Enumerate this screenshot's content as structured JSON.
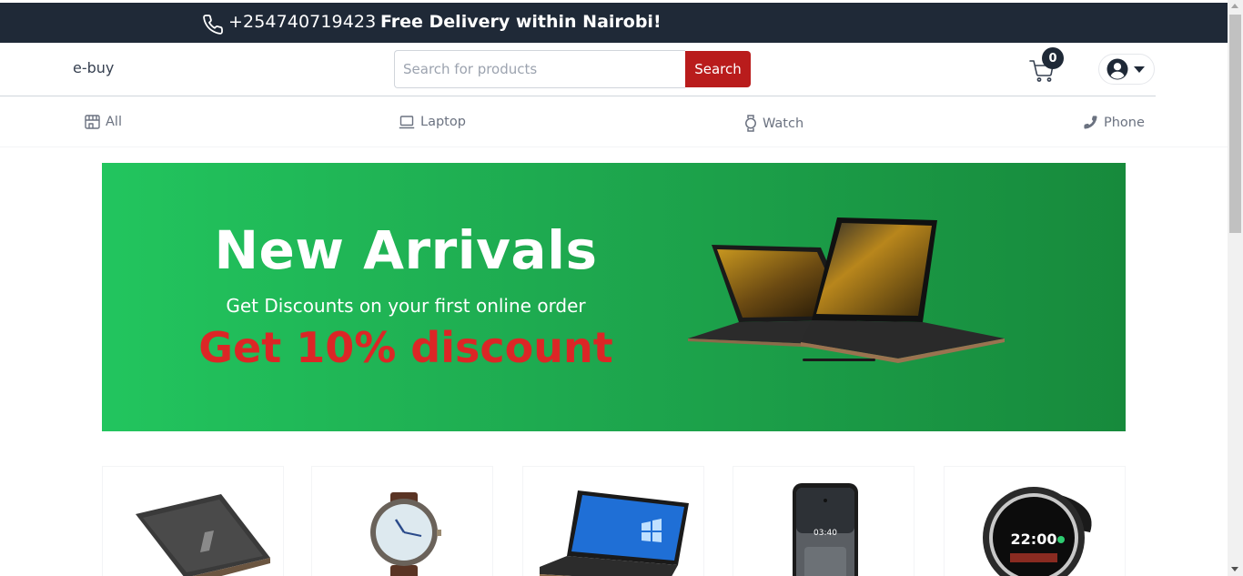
{
  "topbar": {
    "phone_icon": "phone-icon",
    "phone": "+254740719423",
    "promo": "Free Delivery within Nairobi!"
  },
  "header": {
    "brand": "e-buy",
    "search_placeholder": "Search for products",
    "search_value": "",
    "search_button": "Search",
    "cart_icon": "cart-icon",
    "cart_count": "0",
    "user_icon": "user-circle-icon",
    "user_caret_icon": "caret-down-icon"
  },
  "categories": [
    {
      "label": "All",
      "icon": "store-icon"
    },
    {
      "label": "Laptop",
      "icon": "laptop-icon"
    },
    {
      "label": "Watch",
      "icon": "watch-icon"
    },
    {
      "label": "Phone",
      "icon": "phone-icon"
    }
  ],
  "hero": {
    "title": "New Arrivals",
    "subtitle": "Get Discounts on your first online order",
    "discount": "Get 10% discount",
    "image": "laptop-image",
    "colors": {
      "bg_start": "#22c55e",
      "bg_end": "#178a3c",
      "discount": "#dc2626"
    }
  },
  "products": [
    {
      "image": "laptop-image"
    },
    {
      "image": "wristwatch-image"
    },
    {
      "image": "laptop-image"
    },
    {
      "image": "smartphone-image"
    },
    {
      "image": "smartwatch-image"
    }
  ],
  "colors": {
    "topbar": "#1f2937",
    "search_button": "#b91c1c",
    "badge": "#1f2937"
  }
}
